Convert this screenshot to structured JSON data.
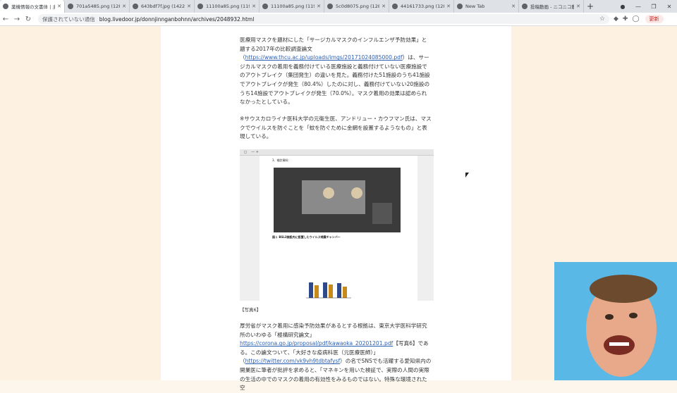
{
  "tabs": [
    {
      "label": "薬機情報の文書体 | 主",
      "active": true
    },
    {
      "label": "701a5485.png (1280×",
      "active": false
    },
    {
      "label": "643bdf7f.jpg (1422×",
      "active": false
    },
    {
      "label": "11100a85.png (1196×",
      "active": false
    },
    {
      "label": "11100a85.png (1196×",
      "active": false
    },
    {
      "label": "5c0d8075.png (1280×",
      "active": false
    },
    {
      "label": "44161733.png (1280×",
      "active": false
    },
    {
      "label": "New Tab",
      "active": false
    },
    {
      "label": "投稿動画 - ニコニコ動画",
      "active": false
    }
  ],
  "address": {
    "security": "保護されていない通信",
    "url": "blog.livedoor.jp/donnjinnganbohnn/archives/2048932.html"
  },
  "update_label": "更新",
  "article": {
    "p1": "医療用マスクを題材にした「サージカルマスクのインフルエンザ予防効果」と題する2017年の比較調査論文",
    "p1_link": "https://www.thcu.ac.jp/uploads/imgs/20171024085000.pdf",
    "p1_rest": "は、サージカルマスクの着用を義務付けている医療施設と義務付けていない医療施設でのアウトブレイク（集団発生）の違いを見た。義務付けた51施設のうち41施設でアウトブレイクが発生（80.4%）したのに対し、義務付けていない20施設のうち14施設でアウトブレイクが発生（70.0%）。マスク着用の効果は認められなかったとしている。",
    "p2": "※サウスカロライナ医科大学の元衛生医、アンドリュー・カウフマン氏は、マスクでウイルスを防ぐことを「蚊を防ぐために金網を設置するようなもの」と表現している。",
    "figure_caption": "【写真6】",
    "fig_heading": "3．検討資料：",
    "fig_cap1": "図１ BSL3施設内に設置したウイルス噴霧チャンバー",
    "p3": "厚労省がマスク着用に感染予防効果があるとする根拠は、東京大学医科学研究所のいわゆる「極構研究論文」",
    "p3_link": "https://corona.go.jp/proposal/pdf/kawaoka_20201201.pdf",
    "p3_rest": "【写真6】である。この論文ついて、「大好きな疫病科医（元医療医師）」",
    "p4_link": "https://twitter.com/vk9vh9tdbtafysf",
    "p4_rest": "の名でSNSでも活躍する愛知県内の開業医に筆者が批評を求めると、「マネキンを用いた検証で、実際の人間の実際の生活の中でのマスクの着用の有効性をみるものではない。特殊な環境された空"
  }
}
